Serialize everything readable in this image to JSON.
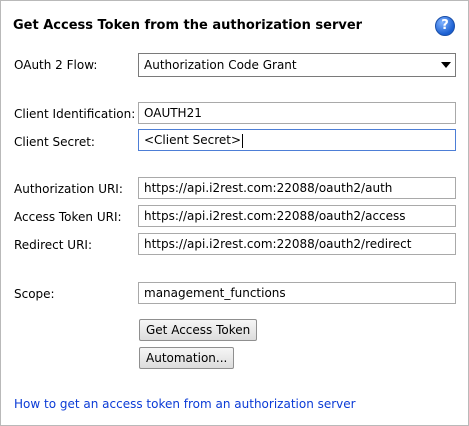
{
  "panel": {
    "title": "Get Access Token from the authorization server",
    "help_glyph": "?"
  },
  "flow": {
    "label": "OAuth 2 Flow:",
    "selected": "Authorization Code Grant"
  },
  "client": {
    "id_label": "Client Identification:",
    "id_value": "OAUTH21",
    "secret_label": "Client Secret:",
    "secret_value": "<Client Secret>"
  },
  "uris": {
    "auth_label": "Authorization URI:",
    "auth_value": "https://api.i2rest.com:22088/oauth2/auth",
    "token_label": "Access Token URI:",
    "token_value": "https://api.i2rest.com:22088/oauth2/access",
    "redirect_label": "Redirect URI:",
    "redirect_value": "https://api.i2rest.com:22088/oauth2/redirect"
  },
  "scope": {
    "label": "Scope:",
    "value": "management_functions"
  },
  "buttons": {
    "get_token": "Get Access Token",
    "automation": "Automation..."
  },
  "help_link": "How to get an access token from an authorization server"
}
